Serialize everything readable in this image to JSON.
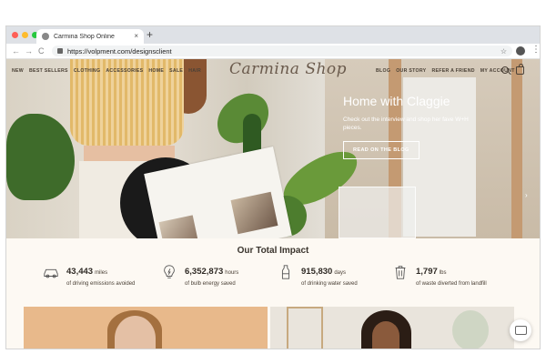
{
  "browser": {
    "tab_title": "Carmina Shop Online",
    "tab_close": "×",
    "new_tab": "+",
    "url": "https://volpment.com/designsclient",
    "back": "←",
    "forward": "→",
    "reload": "C",
    "star": "☆",
    "menu": "⋮",
    "dot_colors": [
      "#fe5f57",
      "#febc2e",
      "#28c840"
    ]
  },
  "site": {
    "logo": "Carmina Shop",
    "nav_left": [
      "NEW",
      "BEST SELLERS",
      "CLOTHING",
      "ACCESSORIES",
      "HOME",
      "SALE",
      "HAIR"
    ],
    "nav_right": [
      "BLOG",
      "OUR STORY",
      "REFER A FRIEND",
      "MY ACCOUNT"
    ],
    "icons": [
      "search-icon",
      "cart-icon"
    ]
  },
  "hero": {
    "title": "Home with Claggie",
    "subtitle": "Check out the interview and shop her fave W+H pieces.",
    "button": "READ ON THE BLOG",
    "arrow": "›"
  },
  "impact": {
    "title": "Our Total Impact",
    "stats": [
      {
        "icon": "car-icon",
        "number": "43,443",
        "unit": "miles",
        "desc": "of driving emissions avoided"
      },
      {
        "icon": "lightbulb-icon",
        "number": "6,352,873",
        "unit": "hours",
        "desc": "of bulb energy saved"
      },
      {
        "icon": "water-bottle-icon",
        "number": "915,830",
        "unit": "days",
        "desc": "of drinking water saved"
      },
      {
        "icon": "trash-can-icon",
        "number": "1,797",
        "unit": "lbs",
        "desc": "of waste diverted from landfill"
      }
    ]
  }
}
